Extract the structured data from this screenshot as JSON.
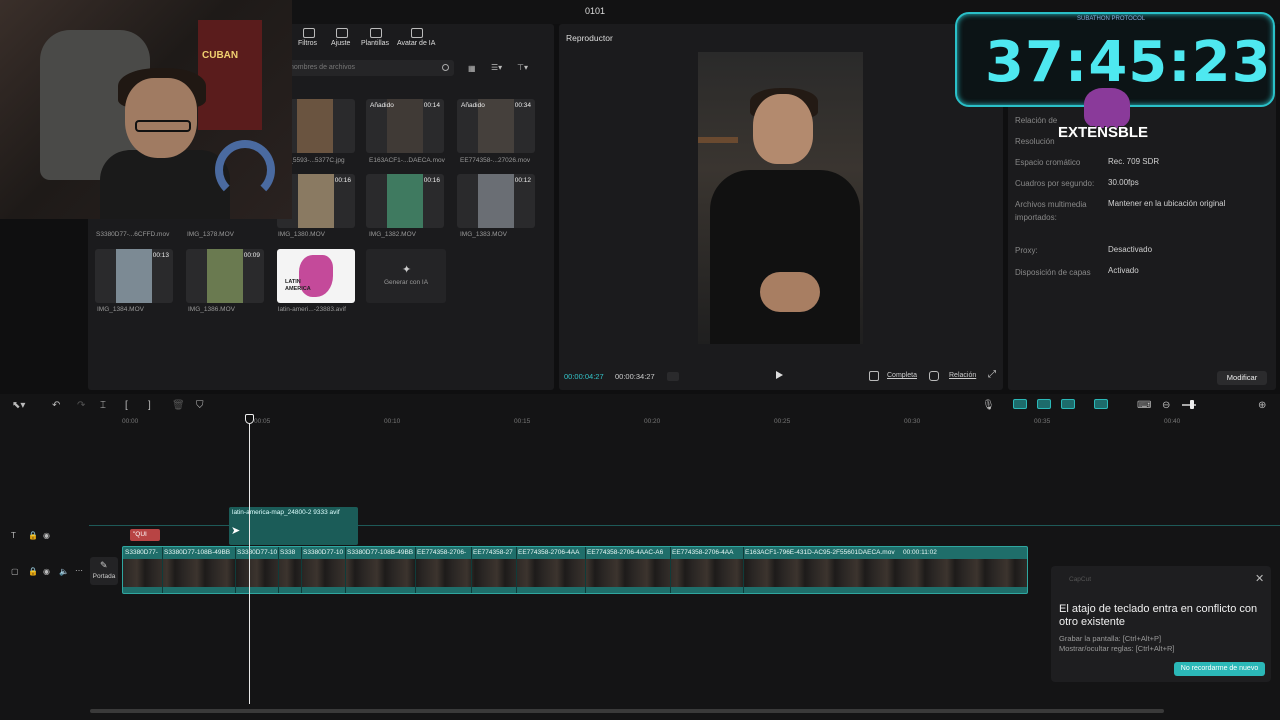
{
  "window": {
    "title": "0101"
  },
  "media_toolbar": {
    "tabs": [
      "Filtros",
      "Ajuste",
      "Plantillas",
      "Avatar de IA"
    ]
  },
  "search": {
    "placeholder": "nombres de archivos"
  },
  "media": {
    "items": [
      {
        "name": "IMG_5593-...5377C.jpg",
        "duration": "",
        "tag": ""
      },
      {
        "name": "E163ACF1-...DAECA.mov",
        "duration": "00:14",
        "tag": "Añadido"
      },
      {
        "name": "EE774358-...27026.mov",
        "duration": "00:34",
        "tag": "Añadido"
      },
      {
        "name": "S3380D77-...6CFFD.mov",
        "duration": "",
        "tag": ""
      },
      {
        "name": "IMG_1378.MOV",
        "duration": "",
        "tag": ""
      },
      {
        "name": "IMG_1380.MOV",
        "duration": "00:16",
        "tag": ""
      },
      {
        "name": "IMG_1382.MOV",
        "duration": "00:16",
        "tag": ""
      },
      {
        "name": "IMG_1383.MOV",
        "duration": "00:12",
        "tag": ""
      },
      {
        "name": "IMG_1384.MOV",
        "duration": "00:13",
        "tag": ""
      },
      {
        "name": "IMG_1386.MOV",
        "duration": "00:09",
        "tag": ""
      },
      {
        "name": "latin-ameri...-23883.avif",
        "duration": "",
        "tag": ""
      }
    ],
    "generate_label": "Generar con IA",
    "latin_thumb_text": "LATIN AMERICA"
  },
  "player": {
    "title": "Reproductor",
    "current_time": "00:00:04:27",
    "total_time": "00:00:34:27",
    "full_label": "Completa",
    "ratio_label": "Relación"
  },
  "details": {
    "rows": [
      {
        "key": "Relación de",
        "value": ""
      },
      {
        "key": "Resolución",
        "value": ""
      },
      {
        "key": "Espacio cromático",
        "value": "Rec. 709 SDR"
      },
      {
        "key": "Cuadros por segundo:",
        "value": "30.00fps"
      },
      {
        "key": "Archivos multimedia importados:",
        "value": "Mantener en la ubicación original"
      },
      {
        "key": "Proxy:",
        "value": "Desactivado"
      },
      {
        "key": "Disposición de capas",
        "value": "Activado"
      }
    ],
    "modify_label": "Modificar"
  },
  "timer": {
    "digits": "37:45:23",
    "subtitle": "SUBATHON PROTOCOL",
    "logo_text": "EXTENSBLE"
  },
  "webcam": {
    "poster_text": "CUBAN"
  },
  "timeline": {
    "ruler": [
      "00:00",
      "00:05",
      "00:10",
      "00:15",
      "00:20",
      "00:25",
      "00:30",
      "00:35",
      "00:40"
    ],
    "overlay_clip": "latin-america-map_24800-2 9333 avif",
    "text_clip": "\"QUI",
    "cover_label": "Portada",
    "main_clips": [
      "S3380D77-",
      "S3380D77-108B-49BB",
      "S3380D77-10",
      "S338",
      "S3380D77-10",
      "S3380D77-108B-49BB",
      "EE774358-2706-",
      "EE774358-27",
      "EE774358-2706-4AA",
      "EE774358-2706-4AAC-A6",
      "EE774358-2706-4AA",
      "E163ACF1-796E-431D-AC95-2F55601DAECA.mov",
      "00:00:11:02"
    ]
  },
  "notification": {
    "app": "CapCut",
    "heading": "El atajo de teclado entra en conflicto con otro existente",
    "line1": "Grabar la pantalla: [Ctrl+Alt+P]",
    "line2": "Mostrar/ocultar reglas: [Ctrl+Alt+R]",
    "button": "No recordarme de nuevo"
  },
  "colors": {
    "accent": "#2bb8b8",
    "timer": "#4ee8f0",
    "clip": "#1f6e6a"
  }
}
